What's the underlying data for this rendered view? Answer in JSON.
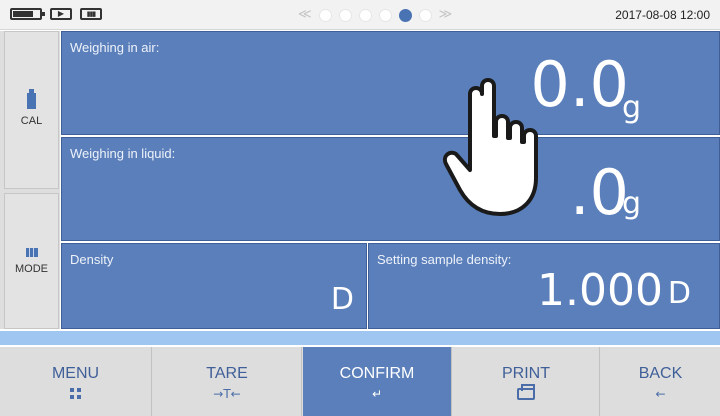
{
  "status_bar": {
    "icons": [
      "battery-icon",
      "usb-icon",
      "signal-icon"
    ],
    "usb_glyph": "▶",
    "signal_glyph": "▮▮▮",
    "pager": {
      "left_arrow": "≪",
      "right_arrow": "≫",
      "pages": 6,
      "active_page": 5
    },
    "datetime": "2017-08-08 12:00"
  },
  "sidebar": {
    "cal_label": "CAL",
    "mode_label": "MODE"
  },
  "panels": {
    "air": {
      "label": "Weighing in air:",
      "value": "0.0",
      "unit": "g"
    },
    "liquid": {
      "label": "Weighing in liquid:",
      "value": ".0",
      "unit": "g"
    },
    "density": {
      "label": "Density",
      "unit": "D"
    },
    "sample_density": {
      "label": "Setting sample density:",
      "value": "1.000",
      "unit": "D"
    }
  },
  "bottom_buttons": {
    "menu": {
      "label": "MENU",
      "icon": "grid-icon"
    },
    "tare": {
      "label": "TARE",
      "sub": "→T←"
    },
    "confirm": {
      "label": "CONFIRM",
      "sub": "↵"
    },
    "print": {
      "label": "PRINT",
      "icon": "printer-icon"
    },
    "back": {
      "label": "BACK",
      "sub": "←"
    }
  },
  "colors": {
    "panel_blue": "#5a7fba",
    "accent_blue": "#4a73b3",
    "strip_blue": "#9ec6f0",
    "button_gray": "#dddddd"
  }
}
